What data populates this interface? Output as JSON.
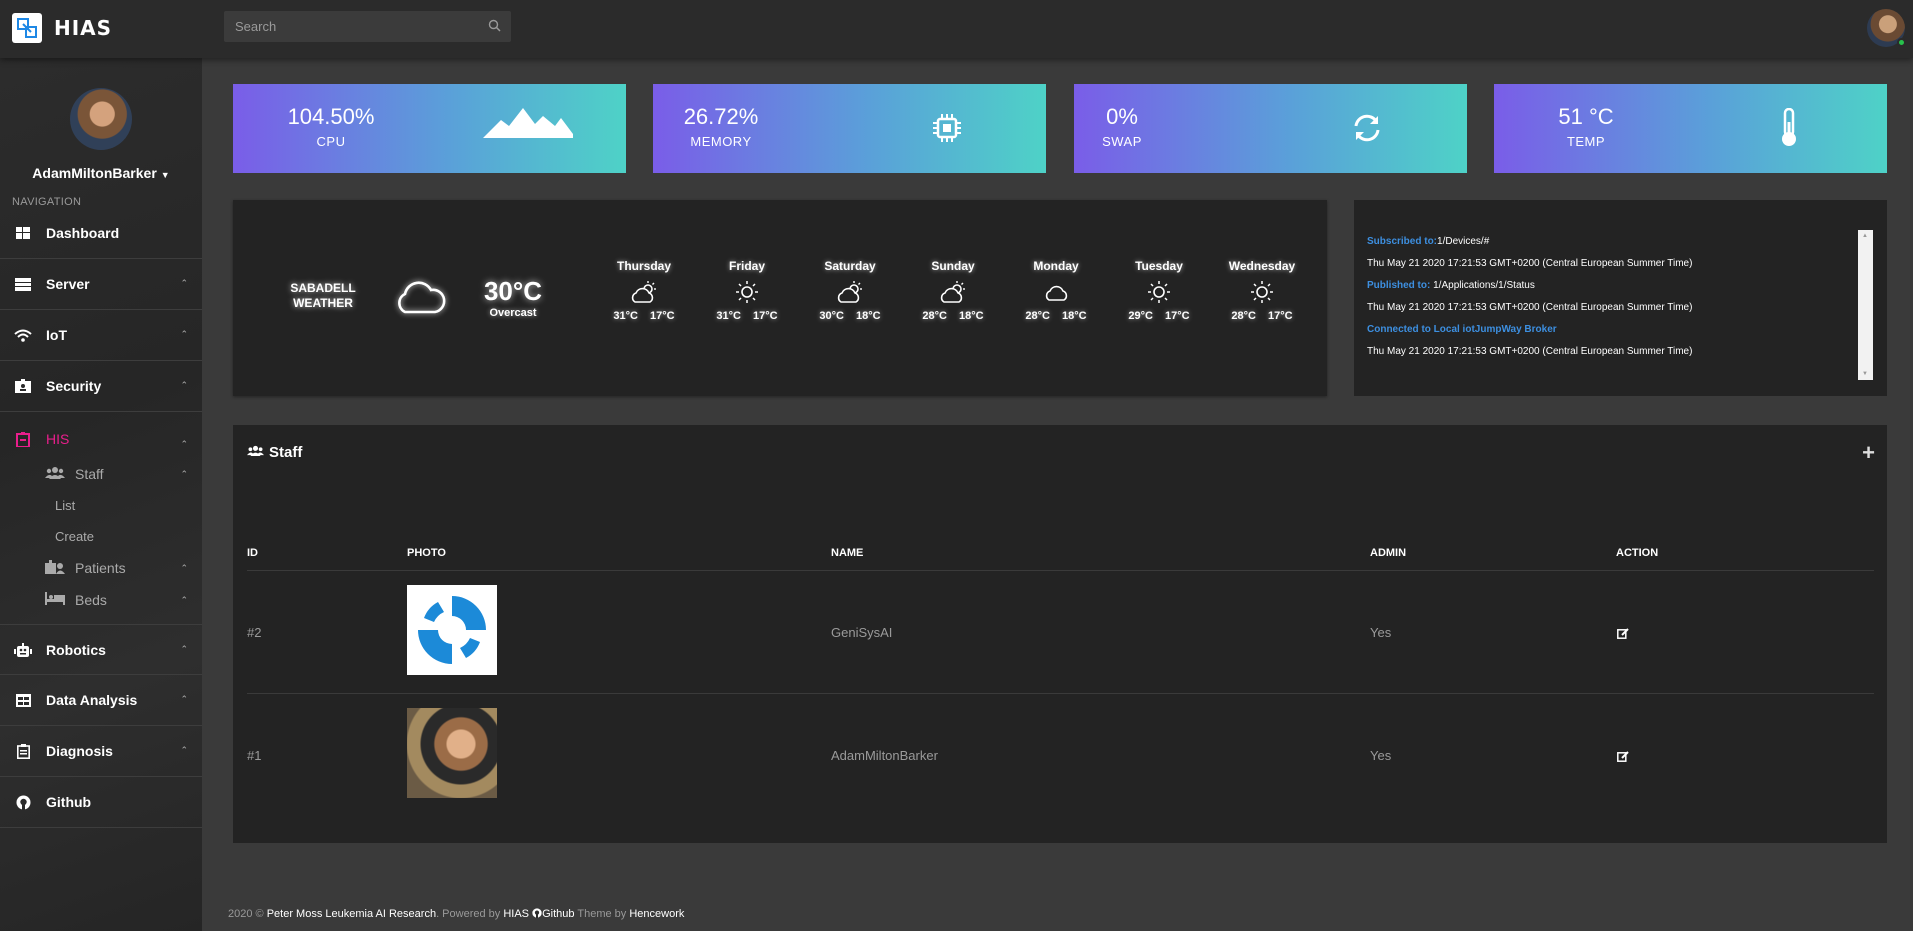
{
  "brand": {
    "title": "HIAS"
  },
  "search": {
    "placeholder": "Search"
  },
  "sidebar": {
    "user_name": "AdamMiltonBarker",
    "nav_heading": "NAVIGATION",
    "items": [
      {
        "label": "Dashboard",
        "icon": "dashboard-icon"
      },
      {
        "label": "Server",
        "icon": "server-icon"
      },
      {
        "label": "IoT",
        "icon": "wifi-icon"
      },
      {
        "label": "Security",
        "icon": "id-badge-icon"
      },
      {
        "label": "HIS",
        "icon": "hospital-icon",
        "active": true
      },
      {
        "label": "Robotics",
        "icon": "robot-icon"
      },
      {
        "label": "Data Analysis",
        "icon": "table-icon"
      },
      {
        "label": "Diagnosis",
        "icon": "clipboard-icon"
      },
      {
        "label": "Github",
        "icon": "github-icon"
      }
    ],
    "his_sub": {
      "staff": "Staff",
      "list": "List",
      "create": "Create",
      "patients": "Patients",
      "beds": "Beds"
    }
  },
  "stats": [
    {
      "value": "104.50%",
      "label": "CPU",
      "icon": "mountain-icon"
    },
    {
      "value": "26.72%",
      "label": "MEMORY",
      "icon": "microchip-icon"
    },
    {
      "value": "0%",
      "label": "SWAP",
      "icon": "sync-icon"
    },
    {
      "value": "51 °C",
      "label": "TEMP",
      "icon": "thermometer-icon"
    }
  ],
  "colors": {
    "accent_pink": "#e91e8c",
    "link_blue": "#3d8fe0",
    "stat_gradient_start": "#7a5de8",
    "stat_gradient_end": "#4ed2c7"
  },
  "weather": {
    "city": "SABADELL",
    "label": "WEATHER",
    "temp": "30°C",
    "condition": "Overcast",
    "days": [
      {
        "name": "Thursday",
        "icon": "partly-sunny-icon",
        "high": "31°C",
        "low": "17°C"
      },
      {
        "name": "Friday",
        "icon": "sun-icon",
        "high": "31°C",
        "low": "17°C"
      },
      {
        "name": "Saturday",
        "icon": "partly-sunny-icon",
        "high": "30°C",
        "low": "18°C"
      },
      {
        "name": "Sunday",
        "icon": "partly-sunny-icon",
        "high": "28°C",
        "low": "18°C"
      },
      {
        "name": "Monday",
        "icon": "cloud-icon",
        "high": "28°C",
        "low": "18°C"
      },
      {
        "name": "Tuesday",
        "icon": "sun-icon",
        "high": "29°C",
        "low": "17°C"
      },
      {
        "name": "Wednesday",
        "icon": "sun-icon",
        "high": "28°C",
        "low": "17°C"
      }
    ]
  },
  "mqtt": {
    "lines": [
      {
        "key": "Subscribed to:",
        "text": "1/Devices/#"
      },
      {
        "key": "",
        "text": "Thu May 21 2020 17:21:53 GMT+0200 (Central European Summer Time)"
      },
      {
        "key": "Published to:",
        "text": " 1/Applications/1/Status"
      },
      {
        "key": "",
        "text": "Thu May 21 2020 17:21:53 GMT+0200 (Central European Summer Time)"
      },
      {
        "key": "Connected to Local iotJumpWay Broker",
        "text": ""
      },
      {
        "key": "",
        "text": "Thu May 21 2020 17:21:53 GMT+0200 (Central European Summer Time)"
      }
    ]
  },
  "staff": {
    "title": "Staff",
    "columns": [
      "ID",
      "PHOTO",
      "NAME",
      "ADMIN",
      "ACTION"
    ],
    "rows": [
      {
        "id": "#2",
        "photo": "genisysai-logo",
        "name": "GeniSysAI",
        "admin": "Yes"
      },
      {
        "id": "#1",
        "photo": "adam-photo",
        "name": "AdamMiltonBarker",
        "admin": "Yes"
      }
    ]
  },
  "footer": {
    "year": "2020 ©",
    "org": "Peter Moss Leukemia AI Research",
    "powered_by": ". Powered by",
    "hias": "HIAS",
    "github": "Github",
    "theme_by": "Theme by",
    "theme_author": "Hencework"
  }
}
